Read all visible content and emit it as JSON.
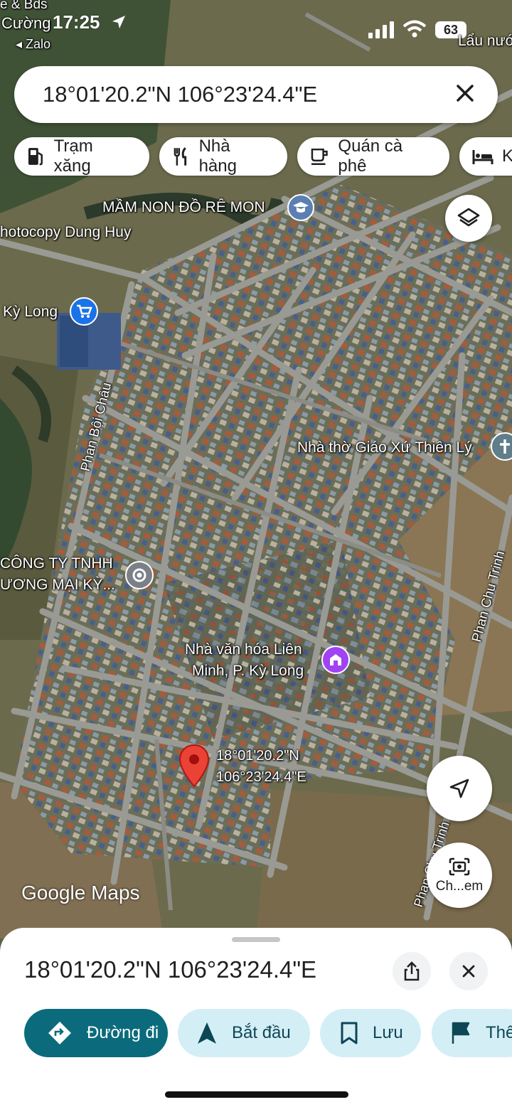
{
  "status_bar": {
    "time": "17:25",
    "back_app": "◂ Zalo",
    "battery": "63",
    "corner_text_1": "e & Bds",
    "corner_text_2": "Cường"
  },
  "search": {
    "query": "18°01'20.2\"N 106°23'24.4\"E"
  },
  "chips": [
    {
      "label": "Trạm xăng",
      "icon": "gas-station-icon"
    },
    {
      "label": "Nhà hàng",
      "icon": "restaurant-icon"
    },
    {
      "label": "Quán cà phê",
      "icon": "coffee-icon"
    },
    {
      "label": "Kh",
      "icon": "hotel-icon"
    }
  ],
  "map_labels": {
    "top_right": "Lẩu nướ",
    "kindergarten": "MẦM NON ĐỒ RÊ MON",
    "photocopy": "hotocopy Dung Huy",
    "store": "Kỳ Long",
    "street_phan_boi_chau": "Phan Bội Châu",
    "church": "Nhà thờ Giáo Xứ Thiên Lý",
    "company_line1": "CÔNG TY TNHH",
    "company_line2": "ƯƠNG MẠI KỲ...",
    "street_phan_chu_trinh": "Phan Chu Trinh",
    "street_phan_chu_trinh_2": "Phan Chu Trinh",
    "culture_house_line1": "Nhà văn hóa Liên",
    "culture_house_line2": "Minh, P. Kỳ Long",
    "pin_line1": "18°01'20.2\"N",
    "pin_line2": "106°23'24.4\"E",
    "watermark": "Google Maps"
  },
  "map_controls": {
    "camera_label": "Ch...em"
  },
  "sheet": {
    "title": "18°01'20.2\"N 106°23'24.4\"E",
    "actions": [
      {
        "label": "Đường đi",
        "icon": "directions-icon",
        "style": "primary"
      },
      {
        "label": "Bắt đầu",
        "icon": "navigation-arrow-icon",
        "style": "secondary"
      },
      {
        "label": "Lưu",
        "icon": "bookmark-icon",
        "style": "secondary"
      },
      {
        "label": "Thê",
        "icon": "flag-icon",
        "style": "secondary"
      }
    ]
  },
  "colors": {
    "accent": "#0b6b7c",
    "pin": "#ea4335",
    "chip_bg": "#ffffff",
    "pill_light": "#d4eef6"
  }
}
